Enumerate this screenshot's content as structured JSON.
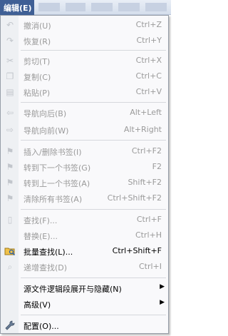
{
  "menubar": {
    "edit_label": "编辑(E)"
  },
  "menu": {
    "items": [
      {
        "label": "撤消(U)",
        "shortcut": "Ctrl+Z",
        "icon": "undo-icon"
      },
      {
        "label": "恢复(R)",
        "shortcut": "Ctrl+Y",
        "icon": "redo-icon"
      },
      {
        "label": "剪切(T)",
        "shortcut": "Ctrl+X",
        "icon": "scissors-icon"
      },
      {
        "label": "复制(C)",
        "shortcut": "Ctrl+C",
        "icon": "copy-icon"
      },
      {
        "label": "粘贴(P)",
        "shortcut": "Ctrl+V",
        "icon": "paste-icon"
      },
      {
        "label": "导航向后(B)",
        "shortcut": "Alt+Left",
        "icon": "arrow-left-icon"
      },
      {
        "label": "导航向前(W)",
        "shortcut": "Alt+Right",
        "icon": "arrow-right-icon"
      },
      {
        "label": "插入/删除书签(I)",
        "shortcut": "Ctrl+F2",
        "icon": "bookmark-toggle-icon"
      },
      {
        "label": "转到下一个书签(G)",
        "shortcut": "F2",
        "icon": "bookmark-next-icon"
      },
      {
        "label": "转到上一个书签(A)",
        "shortcut": "Shift+F2",
        "icon": "bookmark-prev-icon"
      },
      {
        "label": "清除所有书签(A)",
        "shortcut": "Ctrl+Shift+F2",
        "icon": "bookmark-clear-icon"
      },
      {
        "label": "查找(F)...",
        "shortcut": "Ctrl+F",
        "icon": "find-icon"
      },
      {
        "label": "替换(E)...",
        "shortcut": "Ctrl+H",
        "icon": ""
      },
      {
        "label": "批量查找(L)...",
        "shortcut": "Ctrl+Shift+F",
        "icon": "folder-find-icon"
      },
      {
        "label": "递增查找(D)",
        "shortcut": "Ctrl+I",
        "icon": "incremental-find-icon"
      },
      {
        "label": "源文件逻辑段展开与隐藏(N)",
        "shortcut": "",
        "icon": ""
      },
      {
        "label": "高级(V)",
        "shortcut": "",
        "icon": ""
      },
      {
        "label": "配置(O)...",
        "shortcut": "",
        "icon": "wrench-icon"
      }
    ]
  }
}
